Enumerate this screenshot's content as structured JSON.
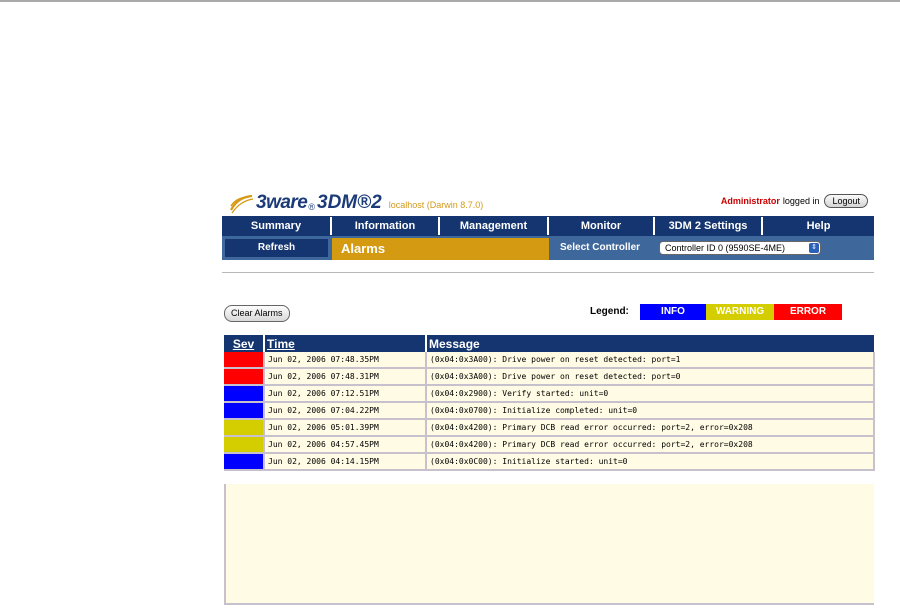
{
  "header": {
    "brand": "3ware",
    "brand_mark": "®",
    "product": "3DM®2",
    "host": "localhost (Darwin 8.7.0)",
    "user": "Administrator",
    "logged_in_text": "logged in",
    "logout_label": "Logout"
  },
  "nav": {
    "items": [
      {
        "label": "Summary"
      },
      {
        "label": "Information"
      },
      {
        "label": "Management"
      },
      {
        "label": "Monitor"
      },
      {
        "label": "3DM 2 Settings"
      },
      {
        "label": "Help"
      }
    ],
    "refresh_label": "Refresh",
    "page_title": "Alarms",
    "select_controller_label": "Select Controller",
    "controller_value": "Controller ID 0 (9590SE-4ME)",
    "select_arrow_icon": "updown-arrow-icon"
  },
  "toolbar": {
    "clear_label": "Clear Alarms",
    "legend_label": "Legend:",
    "legend": [
      {
        "label": "INFO",
        "color": "#0000ff"
      },
      {
        "label": "WARNING",
        "color": "#d4cd00"
      },
      {
        "label": "ERROR",
        "color": "#ff0000"
      }
    ]
  },
  "table": {
    "columns": [
      "Sev",
      "Time",
      "Message"
    ],
    "rows": [
      {
        "sev_color": "#ff0000",
        "time": "Jun 02, 2006 07:48.35PM",
        "message": "(0x04:0x3A00): Drive power on reset detected: port=1"
      },
      {
        "sev_color": "#ff0000",
        "time": "Jun 02, 2006 07:48.31PM",
        "message": "(0x04:0x3A00): Drive power on reset detected: port=0"
      },
      {
        "sev_color": "#0000ff",
        "time": "Jun 02, 2006 07:12.51PM",
        "message": "(0x04:0x2900): Verify started: unit=0"
      },
      {
        "sev_color": "#0000ff",
        "time": "Jun 02, 2006 07:04.22PM",
        "message": "(0x04:0x0700): Initialize completed: unit=0"
      },
      {
        "sev_color": "#d4cd00",
        "time": "Jun 02, 2006 05:01.39PM",
        "message": "(0x04:0x4200): Primary DCB read error occurred: port=2, error=0x208"
      },
      {
        "sev_color": "#d4cd00",
        "time": "Jun 02, 2006 04:57.45PM",
        "message": "(0x04:0x4200): Primary DCB read error occurred: port=2, error=0x208"
      },
      {
        "sev_color": "#0000ff",
        "time": "Jun 02, 2006 04:14.15PM",
        "message": "(0x04:0x0C00): Initialize started: unit=0"
      }
    ]
  }
}
